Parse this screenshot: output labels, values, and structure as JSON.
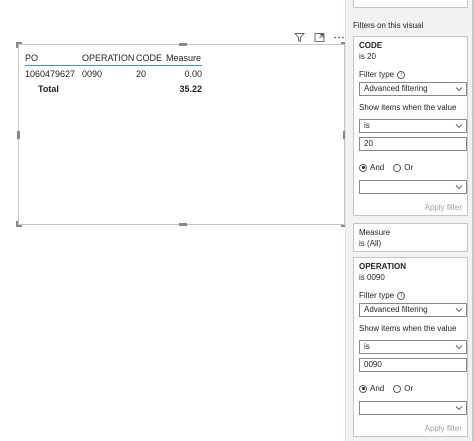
{
  "visual": {
    "table": {
      "columns": [
        "PO",
        "OPERATION",
        "CODE",
        "Measure"
      ],
      "rows": [
        [
          "1060479627",
          "0090",
          "20",
          "0.00"
        ]
      ],
      "total": {
        "label": "Total",
        "measure": "35.22"
      }
    },
    "header_icons": [
      "filter-icon",
      "focus-mode-icon",
      "more-options-icon"
    ]
  },
  "filters_pane": {
    "title": "Filters on this visual",
    "cards": [
      {
        "name": "CODE",
        "summary": "is 20",
        "filter_type_label": "Filter type",
        "filter_type_value": "Advanced filtering",
        "show_items_label": "Show items when the value",
        "condition1_operator": "is",
        "condition1_value": "20",
        "and_label": "And",
        "or_label": "Or",
        "selected_logic": "And",
        "condition2_operator": "",
        "apply_label": "Apply filter"
      },
      {
        "name": "Measure",
        "summary": "is (All)"
      },
      {
        "name": "OPERATION",
        "summary": "is 0090",
        "filter_type_label": "Filter type",
        "filter_type_value": "Advanced filtering",
        "show_items_label": "Show items when the value",
        "condition1_operator": "is",
        "condition1_value": "0090",
        "and_label": "And",
        "or_label": "Or",
        "selected_logic": "And",
        "condition2_operator": "",
        "apply_label": "Apply filter"
      }
    ]
  },
  "colors": {
    "header_underline": "#4a90c2",
    "pane_background": "#f3f2f1",
    "border": "#c8c6c4",
    "disabled_text": "#a19f9d"
  }
}
